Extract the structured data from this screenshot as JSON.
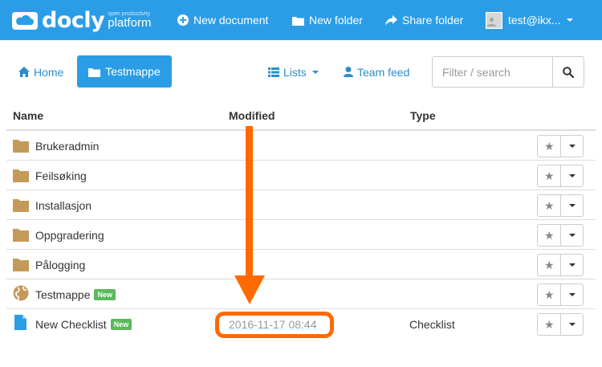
{
  "app": {
    "brand_word": "docly",
    "brand_tagline_small": "open productivity",
    "brand_tagline_big": "platform",
    "accent_color": "#2b9de6",
    "annotation_color": "#ff6a00"
  },
  "topnav": {
    "new_document": "New document",
    "new_folder": "New folder",
    "share_folder": "Share folder",
    "user": "test@ikx..."
  },
  "toolbar": {
    "home": "Home",
    "current_folder": "Testmappe",
    "lists": "Lists",
    "team_feed": "Team feed",
    "search_placeholder": "Filter / search"
  },
  "table": {
    "headers": {
      "name": "Name",
      "modified": "Modified",
      "type": "Type"
    },
    "rows": [
      {
        "icon": "folder-icon",
        "name": "Brukeradmin",
        "badge": "",
        "modified": "",
        "type": ""
      },
      {
        "icon": "folder-icon",
        "name": "Feilsøking",
        "badge": "",
        "modified": "",
        "type": ""
      },
      {
        "icon": "folder-icon",
        "name": "Installasjon",
        "badge": "",
        "modified": "",
        "type": ""
      },
      {
        "icon": "folder-icon",
        "name": "Oppgradering",
        "badge": "",
        "modified": "",
        "type": ""
      },
      {
        "icon": "folder-icon",
        "name": "Pålogging",
        "badge": "",
        "modified": "",
        "type": ""
      },
      {
        "icon": "shared-folder-icon",
        "name": "Testmappe",
        "badge": "New",
        "modified": "",
        "type": ""
      },
      {
        "icon": "document-icon",
        "name": "New Checklist",
        "badge": "New",
        "modified": "2016-11-17 08:44",
        "type": "Checklist"
      }
    ],
    "star_glyph": "★"
  }
}
